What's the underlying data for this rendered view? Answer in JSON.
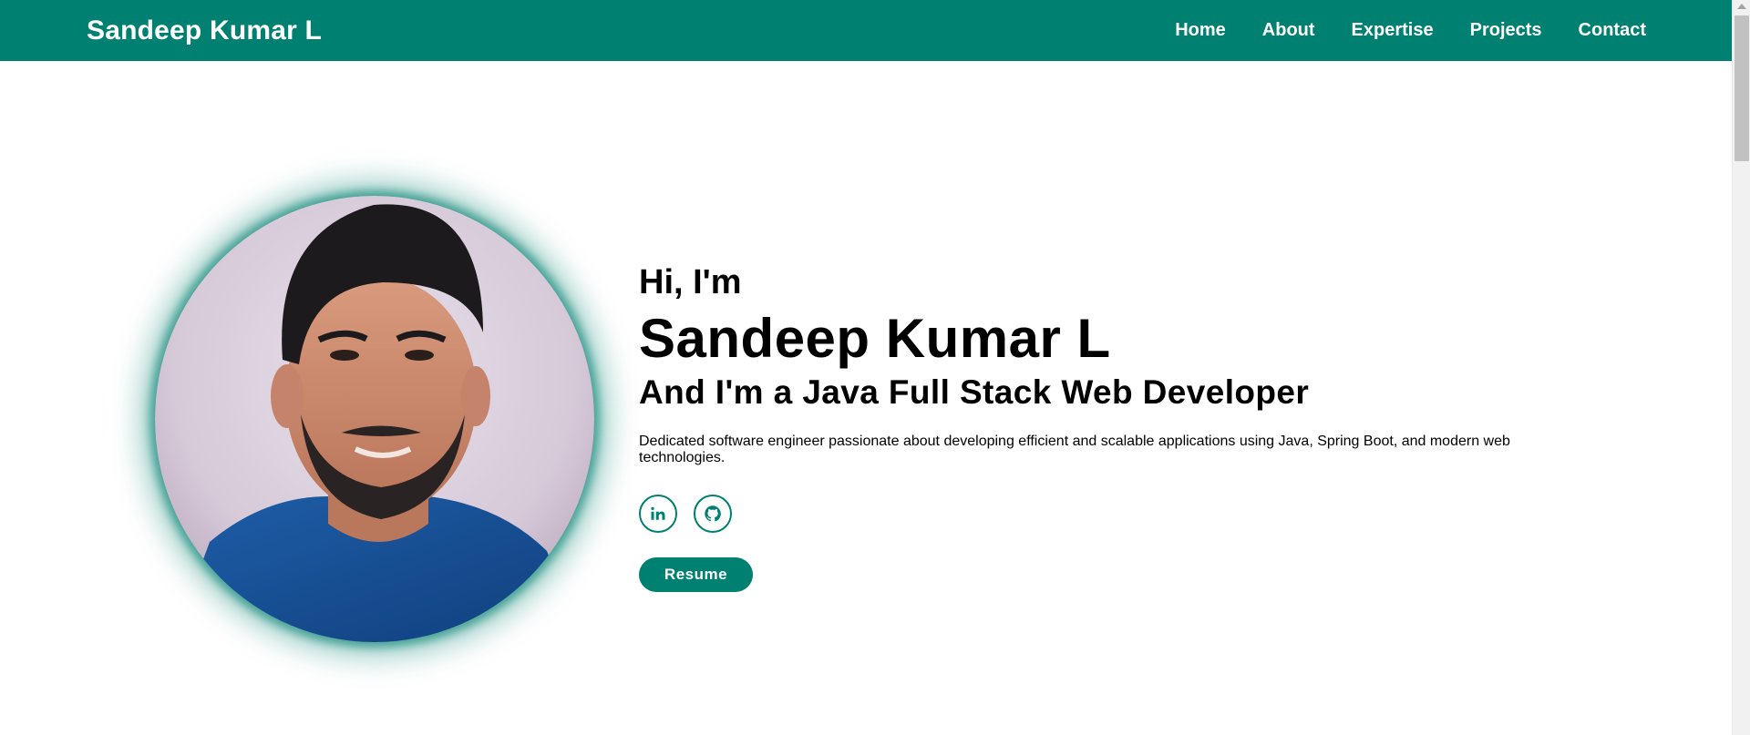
{
  "header": {
    "brand": "Sandeep Kumar L",
    "nav": [
      {
        "label": "Home"
      },
      {
        "label": "About"
      },
      {
        "label": "Expertise"
      },
      {
        "label": "Projects"
      },
      {
        "label": "Contact"
      }
    ]
  },
  "hero": {
    "greeting": "Hi, I'm",
    "name": "Sandeep Kumar L",
    "role": "And I'm a Java Full Stack Web Developer",
    "description": "Dedicated software engineer passionate about developing efficient and scalable applications using Java, Spring Boot, and modern web technologies.",
    "socials": [
      {
        "icon": "linkedin-icon"
      },
      {
        "icon": "github-icon"
      }
    ],
    "resume_label": "Resume",
    "avatar_icon": "profile-photo"
  },
  "theme": {
    "accent": "#008071",
    "background": "#ffffff",
    "text": "#000000"
  }
}
